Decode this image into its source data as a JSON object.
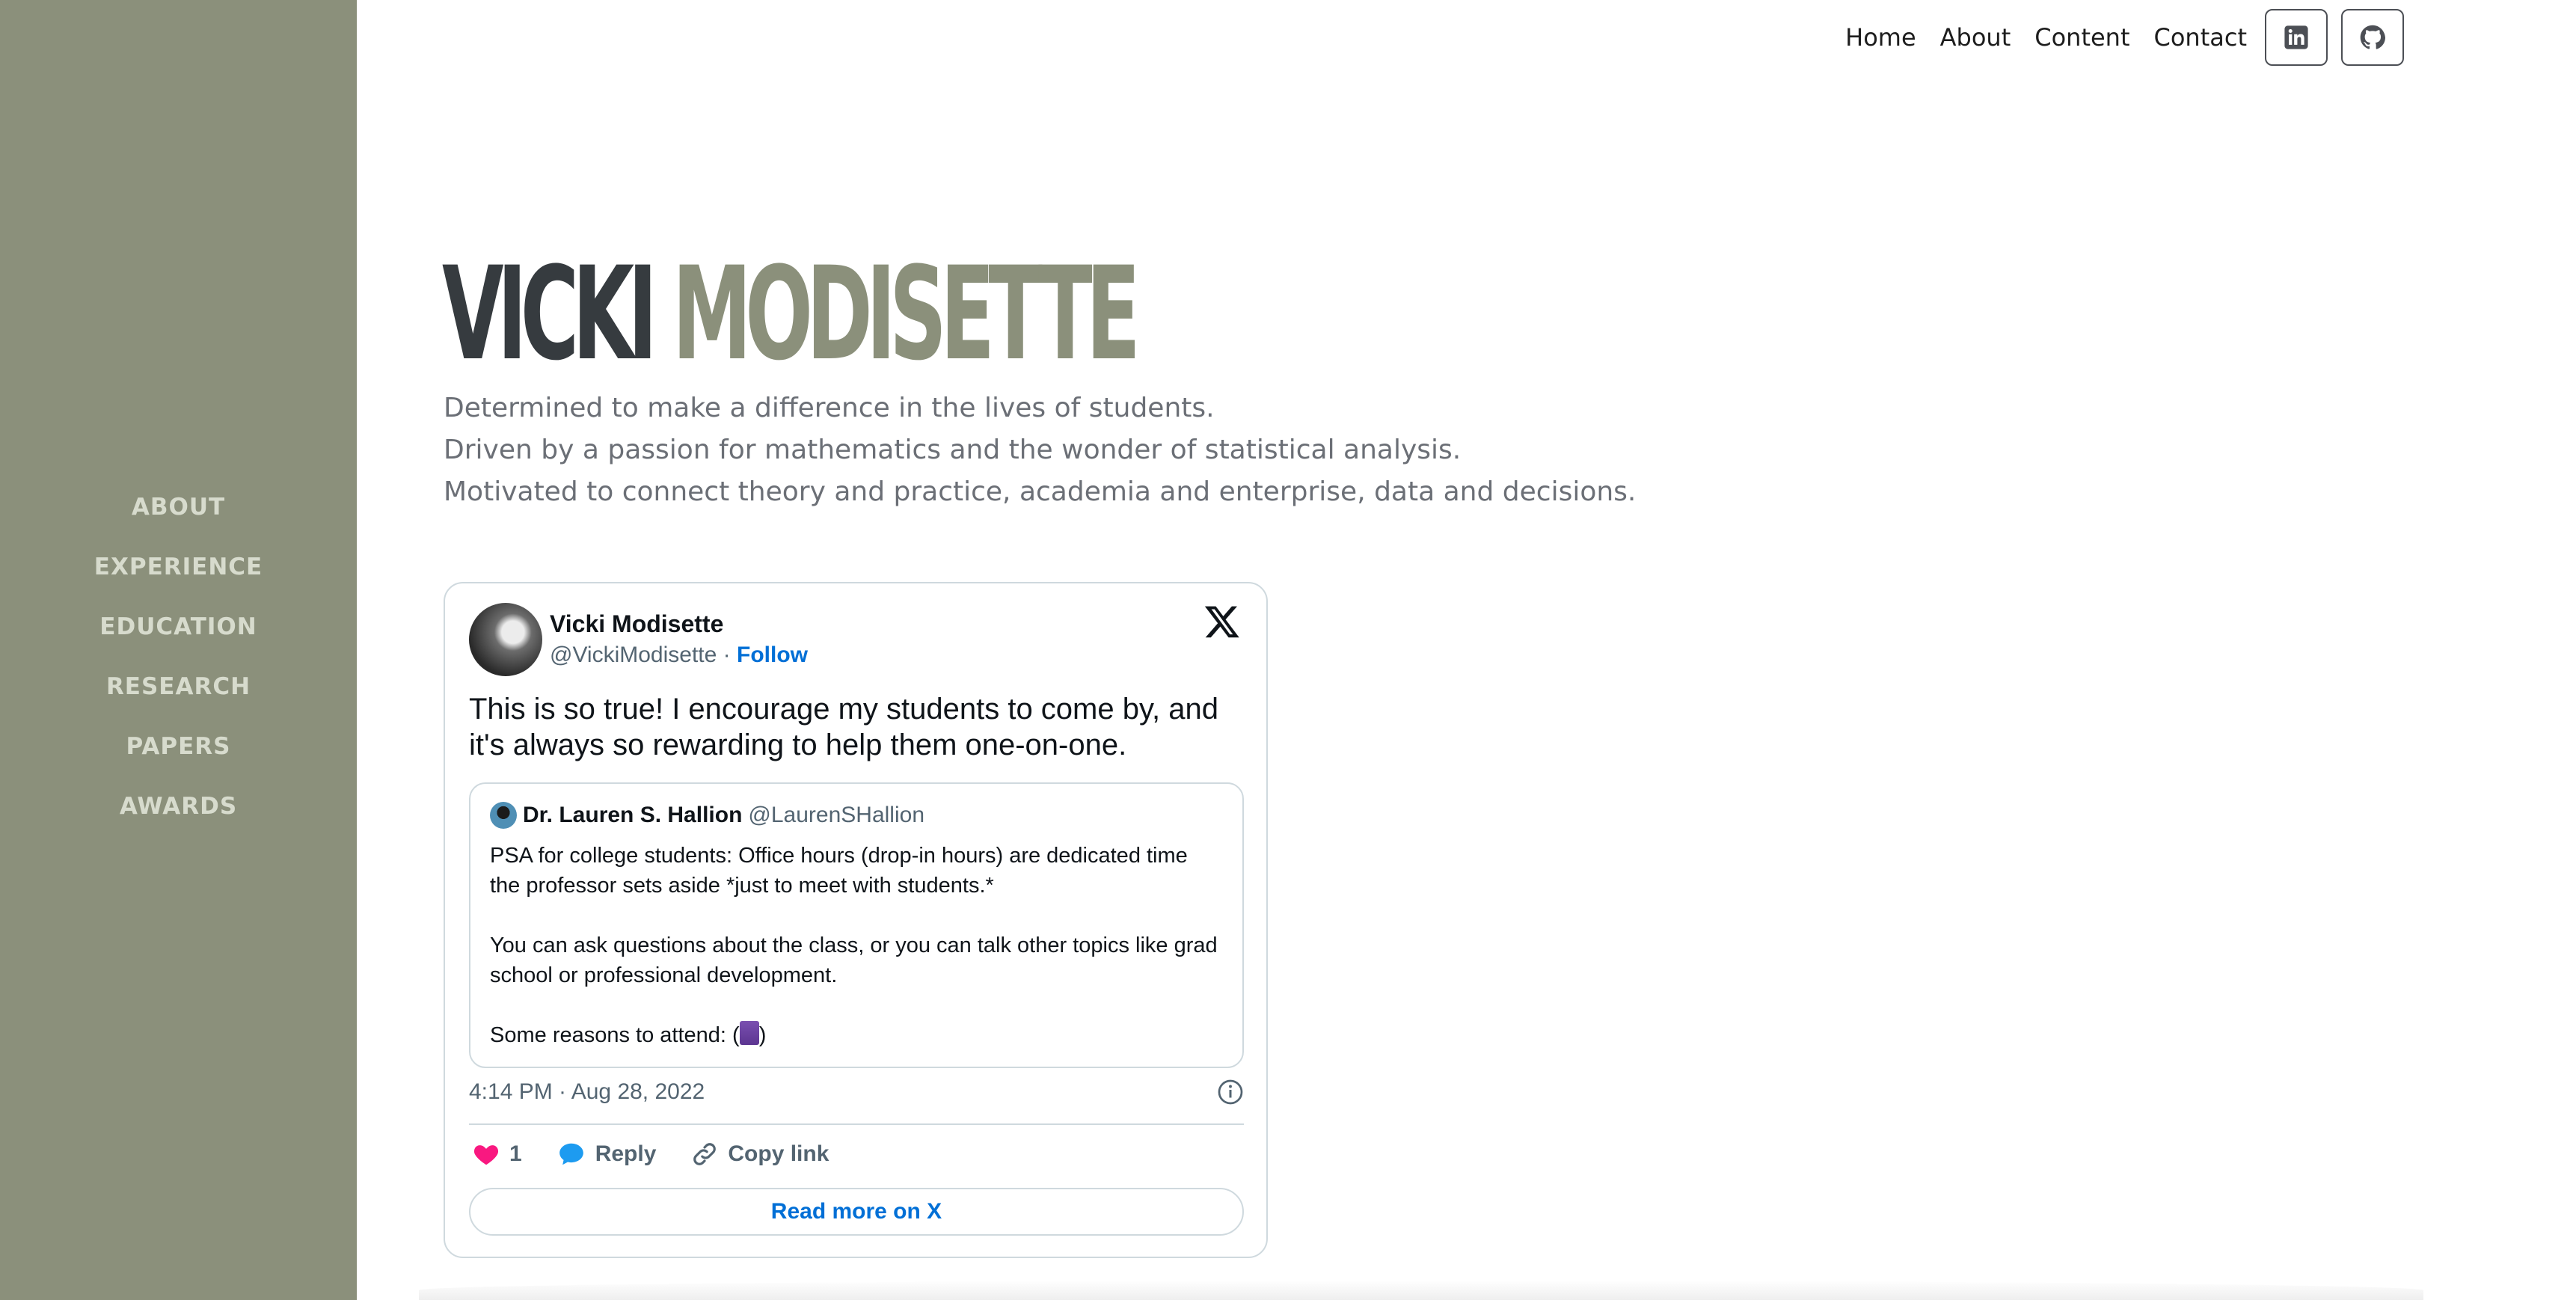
{
  "sidebar": {
    "items": [
      {
        "label": "ABOUT"
      },
      {
        "label": "EXPERIENCE"
      },
      {
        "label": "EDUCATION"
      },
      {
        "label": "RESEARCH"
      },
      {
        "label": "PAPERS"
      },
      {
        "label": "AWARDS"
      }
    ]
  },
  "topnav": {
    "links": [
      {
        "label": "Home"
      },
      {
        "label": "About"
      },
      {
        "label": "Content"
      },
      {
        "label": "Contact"
      }
    ],
    "icons": [
      "linkedin-icon",
      "github-icon"
    ]
  },
  "hero": {
    "first_name": "VICKI",
    "last_name": "MODISETTE",
    "taglines": [
      "Determined to make a difference in the lives of students.",
      "Driven by a passion for mathematics and the wonder of statistical analysis.",
      "Motivated to connect theory and practice, academia and enterprise, data and decisions."
    ]
  },
  "tweet": {
    "author": "Vicki Modisette",
    "handle": "@VickiModisette",
    "separator": "·",
    "follow": "Follow",
    "text": "This is so true! I encourage my students to come by, and it's always so rewarding to help them one-on-one.",
    "quote": {
      "author": "Dr. Lauren S. Hallion",
      "handle": "@LaurenSHallion",
      "text": "PSA for college students: Office hours (drop-in hours) are dedicated time the professor sets aside *just to meet with students.*\n\nYou can ask questions about the class, or you can talk other topics like grad school or professional development.\n\nSome reasons to attend: (",
      "text_end": ")"
    },
    "timestamp": "4:14 PM · Aug 28, 2022",
    "likes": "1",
    "reply_label": "Reply",
    "copy_label": "Copy link",
    "read_more": "Read more on X"
  },
  "colors": {
    "sidebar_bg": "#8b907b",
    "title_dark": "#363b3f",
    "title_accent": "#8b907b",
    "link_blue": "#006fd6",
    "like_pink": "#f91880"
  }
}
